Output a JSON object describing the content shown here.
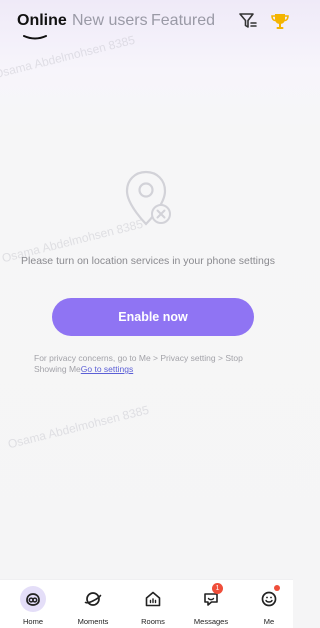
{
  "header": {
    "tabs": [
      {
        "label": "Online",
        "active": true
      },
      {
        "label": "New users",
        "active": false
      },
      {
        "label": "Featured",
        "active": false
      }
    ],
    "icons": [
      "filter-icon",
      "trophy-icon"
    ]
  },
  "empty_state": {
    "icon": "location-pin-off-icon",
    "message": "Please turn on location services in your phone settings",
    "button_label": "Enable now",
    "privacy_text": "For privacy concerns, go to Me > Privacy setting > Stop Showing Me",
    "privacy_link": "Go to settings"
  },
  "watermark": "Osama Abdelmohsen 8385",
  "bottom_nav": {
    "items": [
      {
        "label": "Home",
        "icon": "home-icon",
        "active": true
      },
      {
        "label": "Moments",
        "icon": "planet-icon",
        "active": false
      },
      {
        "label": "Rooms",
        "icon": "rooms-icon",
        "active": false
      },
      {
        "label": "Messages",
        "icon": "message-icon",
        "badge": "1",
        "active": false
      },
      {
        "label": "Me",
        "icon": "smile-icon",
        "dot": true,
        "active": false
      }
    ]
  },
  "colors": {
    "accent": "#8f74f3",
    "badge": "#ef4e3a",
    "link": "#5b5fd6"
  }
}
